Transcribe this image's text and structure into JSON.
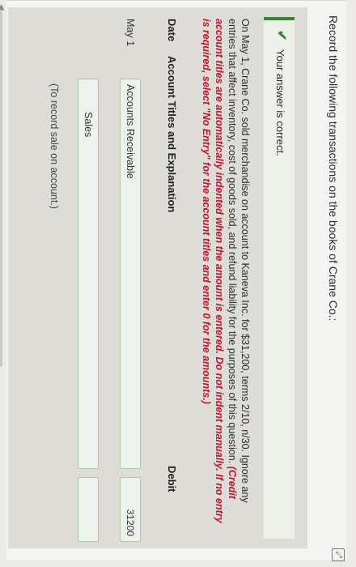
{
  "instruction": "Record the following transactions on the books of Crane Co.:",
  "feedback": {
    "text": "Your answer is correct."
  },
  "problem": {
    "text": "On May 1, Crane Co. sold merchandise on account to Kaneva Inc. for $31,200, terms 2/10, n/30. Ignore any entries that affect inventory, cost of goods sold, and refund liability for the purposes of this question.",
    "instructions": "(Credit account titles are automatically indented when the amount is entered. Do not indent manually. If no entry is required, select \"No Entry\" for the account titles and enter 0 for the amounts.)"
  },
  "table": {
    "headers": {
      "date": "Date",
      "account": "Account Titles and Explanation",
      "debit": "Debit"
    },
    "rows": [
      {
        "date": "May 1",
        "account": "Accounts Receivable",
        "debit": "31200"
      },
      {
        "date": "",
        "account": "Sales",
        "debit": ""
      }
    ],
    "note": "(To record sale on account.)"
  }
}
